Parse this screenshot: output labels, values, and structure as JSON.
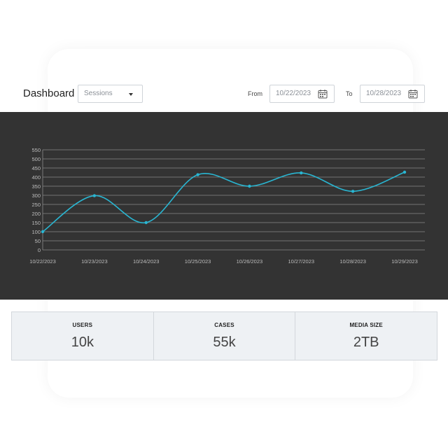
{
  "header": {
    "title": "Dashboard",
    "metric_select": {
      "value": "Sessions"
    },
    "from_label": "From",
    "from_date": "10/22/2023",
    "to_label": "To",
    "to_date": "10/28/2023"
  },
  "colors": {
    "line": "#29b6d2",
    "panel_bg": "#333333",
    "grid": "#8a8a8a",
    "stat_bg": "#eef1f4"
  },
  "icons": {
    "calendar": "calendar-icon",
    "caret": "chevron-down-icon"
  },
  "chart_data": {
    "type": "line",
    "title": "",
    "xlabel": "",
    "ylabel": "",
    "categories": [
      "10/22/2023",
      "10/23/2023",
      "10/24/2023",
      "10/25/2023",
      "10/26/2023",
      "10/27/2023",
      "10/28/2023",
      "10/29/2023"
    ],
    "series": [
      {
        "values": [
          100,
          298,
          150,
          413,
          350,
          423,
          322,
          427
        ]
      }
    ],
    "ylim": [
      0,
      550
    ],
    "yticks": [
      0,
      50,
      100,
      150,
      200,
      250,
      300,
      350,
      400,
      450,
      500,
      550
    ],
    "grid": true,
    "legend": "none",
    "smooth": true
  },
  "stats": [
    {
      "label": "USERS",
      "value": "10k"
    },
    {
      "label": "CASES",
      "value": "55k"
    },
    {
      "label": "MEDIA SIZE",
      "value": "2TB"
    }
  ]
}
